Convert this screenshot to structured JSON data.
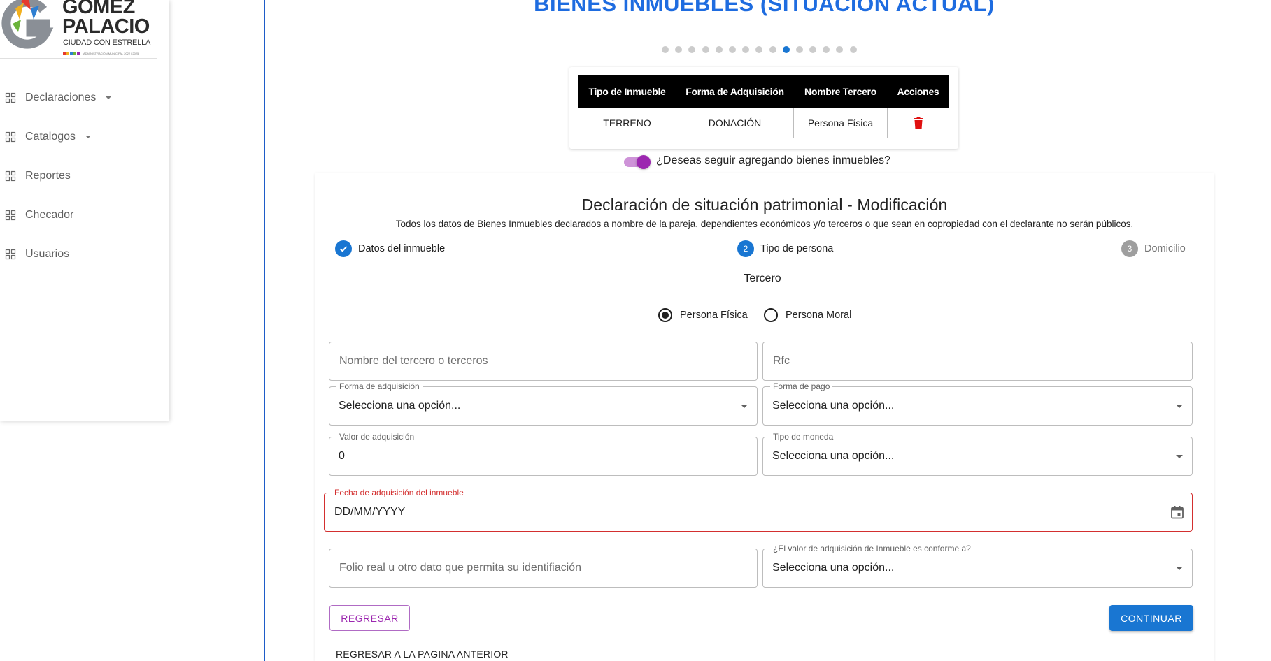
{
  "logo": {
    "line1": "GÓMEZ",
    "line2": "PALACIO",
    "tagline": "CIUDAD CON ESTRELLA",
    "small": "ADMINISTRACIÓN MUNICIPAL 2022 | 2025"
  },
  "sidebar": {
    "items": [
      {
        "label": "Declaraciones",
        "has_caret": true
      },
      {
        "label": "Catalogos",
        "has_caret": true
      },
      {
        "label": "Reportes",
        "has_caret": false
      },
      {
        "label": "Checador",
        "has_caret": false
      },
      {
        "label": "Usuarios",
        "has_caret": false
      }
    ]
  },
  "page": {
    "title": "BIENES INMUEBLES (SITUACIÓN ACTUAL)",
    "dots_total": 15,
    "dots_active_index": 9
  },
  "table": {
    "headers": [
      "Tipo de Inmueble",
      "Forma de Adquisición",
      "Nombre Tercero",
      "Acciones"
    ],
    "rows": [
      {
        "tipo": "TERRENO",
        "forma": "DONACIÓN",
        "tercero": "Persona Física",
        "action_icon": "trash-icon"
      }
    ]
  },
  "toggle": {
    "label": "¿Deseas seguir agregando bienes inmuebles?",
    "checked": true
  },
  "form": {
    "title": "Declaración de situación patrimonial - Modificación",
    "note": "Todos los datos de Bienes Inmuebles declarados a nombre de la pareja, dependientes económicos y/o terceros o que sean en copropiedad con el declarante no serán públicos.",
    "steps": [
      {
        "number": "1",
        "label": "Datos del inmueble",
        "state": "completed"
      },
      {
        "number": "2",
        "label": "Tipo de persona",
        "state": "active"
      },
      {
        "number": "3",
        "label": "Domicilio",
        "state": "pending"
      }
    ],
    "section_label": "Tercero",
    "radios": [
      {
        "label": "Persona Física",
        "selected": true
      },
      {
        "label": "Persona Moral",
        "selected": false
      }
    ],
    "fields": {
      "nombre_placeholder": "Nombre del tercero o terceros",
      "rfc_placeholder": "Rfc",
      "forma_adquisicion_label": "Forma de adquisición",
      "forma_adquisicion_value": "Selecciona una opción...",
      "forma_pago_label": "Forma de pago",
      "forma_pago_value": "Selecciona una opción...",
      "valor_label": "Valor de adquisición",
      "valor_value": "0",
      "moneda_label": "Tipo de moneda",
      "moneda_value": "Selecciona una opción...",
      "fecha_label": "Fecha de adquisición del inmueble",
      "fecha_value": "DD/MM/YYYY",
      "folio_placeholder": "Folio real u otro dato que permita su identifiación",
      "conforme_label": "¿El valor de adquisición de Inmueble es conforme a?",
      "conforme_value": "Selecciona una opción..."
    },
    "back_button": "REGRESAR",
    "continue_button": "CONTINUAR",
    "prev_link": "REGRESAR A LA PAGINA ANTERIOR"
  },
  "colors": {
    "primary": "#1976d2",
    "title_blue": "#1e6ce0",
    "secondary": "#9c27b0",
    "error": "#d32f2f",
    "trash": "#e01010"
  }
}
